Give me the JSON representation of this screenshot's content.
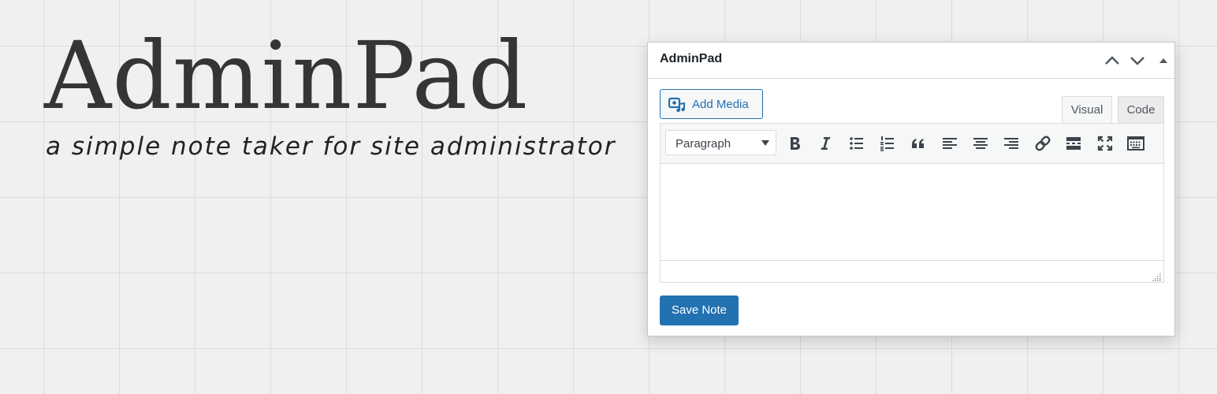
{
  "hero": {
    "title": "AdminPad",
    "tagline": "a simple note taker for site administrator"
  },
  "widget": {
    "title": "AdminPad",
    "header_controls": [
      "chevron-up-icon",
      "chevron-down-icon",
      "triangle-up-icon"
    ],
    "add_media_label": "Add Media",
    "tabs": [
      {
        "label": "Visual",
        "active": true
      },
      {
        "label": "Code",
        "active": false
      }
    ],
    "toolbar": {
      "format_value": "Paragraph",
      "buttons": [
        "bold-icon",
        "italic-icon",
        "bulleted-list-icon",
        "numbered-list-icon",
        "blockquote-icon",
        "align-left-icon",
        "align-center-icon",
        "align-right-icon",
        "link-icon",
        "read-more-icon",
        "fullscreen-icon",
        "toolbar-toggle-icon"
      ]
    },
    "editor_content": "",
    "save_label": "Save Note"
  },
  "colors": {
    "accent": "#2271b1",
    "background": "#f0f0f0",
    "grid": "#dcdcdc",
    "icon": "#3c434a"
  }
}
